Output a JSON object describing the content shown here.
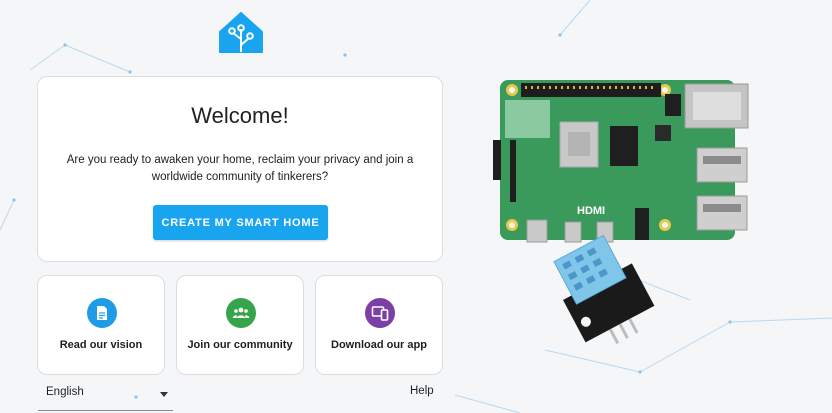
{
  "welcome": {
    "title": "Welcome!",
    "description": "Are you ready to awaken your home, reclaim your privacy and join a worldwide community of tinkerers?",
    "create_button": "CREATE MY SMART HOME"
  },
  "cards": [
    {
      "label": "Read our vision",
      "icon": "document-icon",
      "color": "#1e9ce8"
    },
    {
      "label": "Join our community",
      "icon": "group-icon",
      "color": "#36a44a"
    },
    {
      "label": "Download our app",
      "icon": "mobile-app-icon",
      "color": "#7b3fa6"
    }
  ],
  "footer": {
    "language": "English",
    "help": "Help"
  },
  "illustration": {
    "board_label": "HDMI"
  },
  "colors": {
    "accent": "#18a4ee",
    "logo": "#18a4ee",
    "board_green": "#3a9a5c"
  }
}
